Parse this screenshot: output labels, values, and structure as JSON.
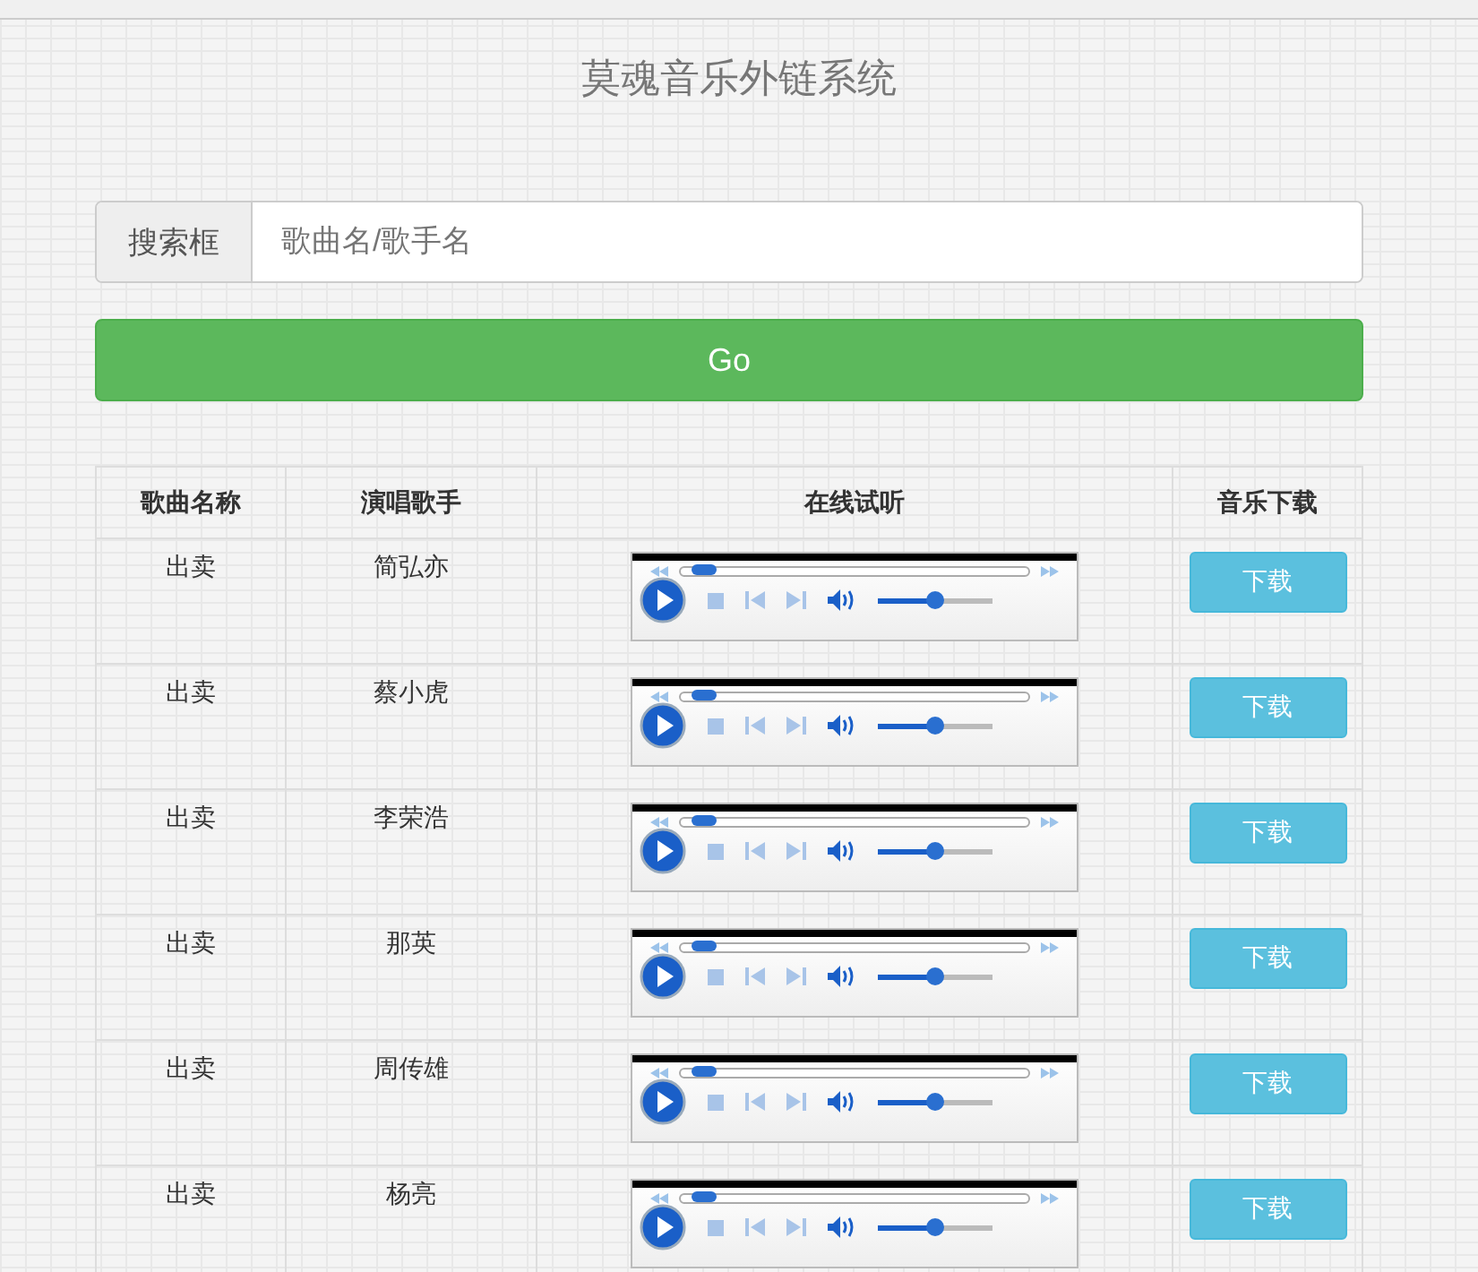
{
  "title": "莫魂音乐外链系统",
  "search": {
    "label": "搜索框",
    "placeholder": "歌曲名/歌手名"
  },
  "go_button": "Go",
  "table": {
    "columns": [
      "歌曲名称",
      "演唱歌手",
      "在线试听",
      "音乐下载"
    ],
    "rows": [
      {
        "song": "出卖",
        "singer": "简弘亦",
        "player": {
          "position": {
            "level": 0.03
          },
          "volume": {
            "level": 0.5
          }
        },
        "download": "下载"
      },
      {
        "song": "出卖",
        "singer": "蔡小虎",
        "player": {
          "position": {
            "level": 0.03
          },
          "volume": {
            "level": 0.5
          }
        },
        "download": "下载"
      },
      {
        "song": "出卖",
        "singer": "李荣浩",
        "player": {
          "position": {
            "level": 0.03
          },
          "volume": {
            "level": 0.5
          }
        },
        "download": "下载"
      },
      {
        "song": "出卖",
        "singer": "那英",
        "player": {
          "position": {
            "level": 0.03
          },
          "volume": {
            "level": 0.5
          }
        },
        "download": "下载"
      },
      {
        "song": "出卖",
        "singer": "周传雄",
        "player": {
          "position": {
            "level": 0.03
          },
          "volume": {
            "level": 0.5
          }
        },
        "download": "下载"
      },
      {
        "song": "出卖",
        "singer": "杨亮",
        "player": {
          "position": {
            "level": 0.03
          },
          "volume": {
            "level": 0.5
          }
        },
        "download": "下载"
      }
    ]
  }
}
